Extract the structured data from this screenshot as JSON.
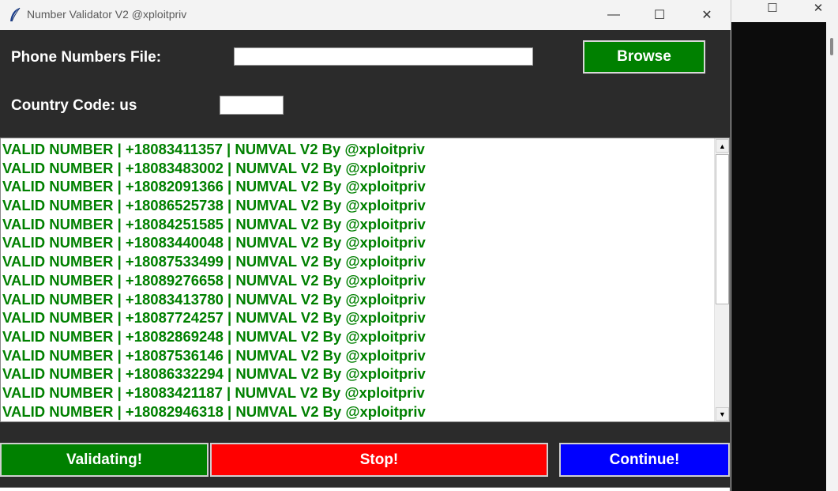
{
  "window": {
    "title": "Number Validator V2 @xploitpriv",
    "controls": {
      "minimize": "—",
      "maximize": "☐",
      "close": "✕"
    }
  },
  "background_window": {
    "maximize": "☐",
    "close": "✕"
  },
  "form": {
    "phone_label": "Phone Numbers File:",
    "phone_value": "",
    "browse_label": "Browse",
    "country_label": "Country Code: us",
    "country_value": ""
  },
  "log": {
    "lines": [
      "VALID NUMBER | +18083411357 | NUMVAL V2 By @xploitpriv",
      "VALID NUMBER | +18083483002 | NUMVAL V2 By @xploitpriv",
      "VALID NUMBER | +18082091366 | NUMVAL V2 By @xploitpriv",
      "VALID NUMBER | +18086525738 | NUMVAL V2 By @xploitpriv",
      "VALID NUMBER | +18084251585 | NUMVAL V2 By @xploitpriv",
      "VALID NUMBER | +18083440048 | NUMVAL V2 By @xploitpriv",
      "VALID NUMBER | +18087533499 | NUMVAL V2 By @xploitpriv",
      "VALID NUMBER | +18089276658 | NUMVAL V2 By @xploitpriv",
      "VALID NUMBER | +18083413780 | NUMVAL V2 By @xploitpriv",
      "VALID NUMBER | +18087724257 | NUMVAL V2 By @xploitpriv",
      "VALID NUMBER | +18082869248 | NUMVAL V2 By @xploitpriv",
      "VALID NUMBER | +18087536146 | NUMVAL V2 By @xploitpriv",
      "VALID NUMBER | +18086332294 | NUMVAL V2 By @xploitpriv",
      "VALID NUMBER | +18083421187 | NUMVAL V2 By @xploitpriv",
      "VALID NUMBER | +18082946318 | NUMVAL V2 By @xploitpriv"
    ],
    "scroll": {
      "up": "▲",
      "down": "▼"
    }
  },
  "actions": {
    "validating_label": "Validating!",
    "stop_label": "Stop!",
    "continue_label": "Continue!"
  },
  "colors": {
    "valid_text": "#008000",
    "validating_bg": "#008000",
    "stop_bg": "#ff0000",
    "continue_bg": "#0000ff",
    "browse_bg": "#008000",
    "window_bg": "#2b2b2b"
  },
  "icons": {
    "app": "feather-icon"
  }
}
